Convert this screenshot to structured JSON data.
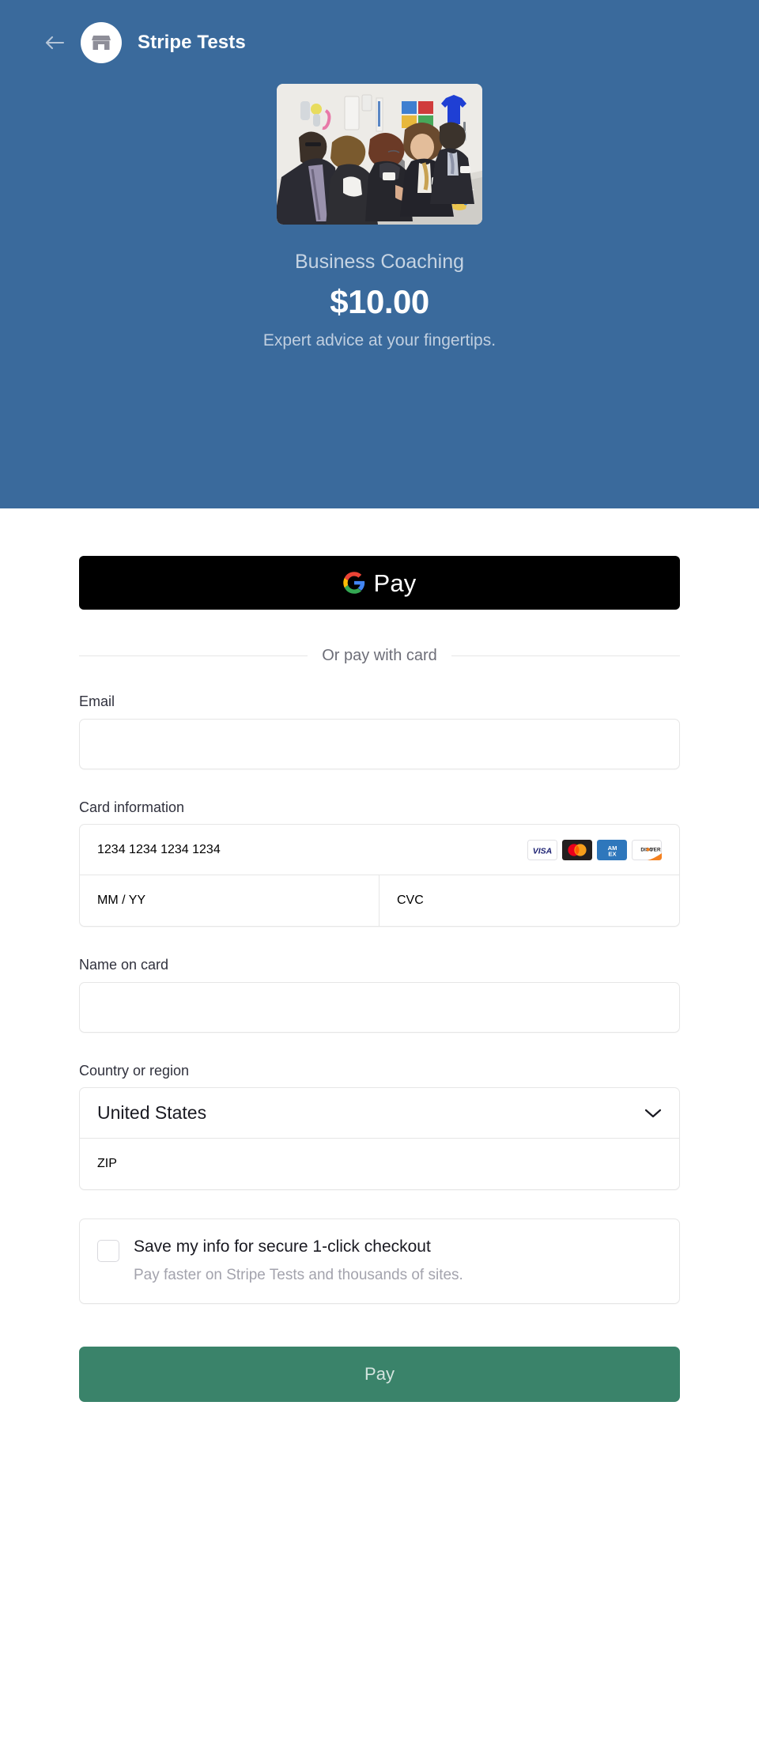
{
  "header": {
    "back_label": "Back",
    "back_icon": "arrow-left-icon",
    "logo_icon": "storefront-icon",
    "merchant_name": "Stripe Tests"
  },
  "product": {
    "image_alt": "Business meeting around a conference table",
    "name": "Business Coaching",
    "price": "$10.00",
    "description": "Expert advice at your fingertips."
  },
  "wallet": {
    "google_pay_label": "Pay",
    "google_pay_icon": "google-g-icon"
  },
  "divider": {
    "label": "Or pay with card"
  },
  "form": {
    "email": {
      "label": "Email",
      "value": "",
      "placeholder": ""
    },
    "card": {
      "label": "Card information",
      "number_placeholder": "1234 1234 1234 1234",
      "number_value": "",
      "expiry_placeholder": "MM / YY",
      "expiry_value": "",
      "cvc_placeholder": "CVC",
      "cvc_value": "",
      "brands": [
        "visa",
        "mastercard",
        "amex",
        "discover"
      ]
    },
    "name_on_card": {
      "label": "Name on card",
      "value": "",
      "placeholder": ""
    },
    "country": {
      "label": "Country or region",
      "selected": "United States",
      "chevron_icon": "chevron-down-icon",
      "zip_placeholder": "ZIP",
      "zip_value": ""
    },
    "save_info": {
      "checked": false,
      "title": "Save my info for secure 1-click checkout",
      "subtitle": "Pay faster on Stripe Tests and thousands of sites."
    },
    "submit_label": "Pay"
  },
  "colors": {
    "summary_background": "#3a6a9c",
    "pay_button": "#3a836a",
    "wallet_button": "#000000",
    "border": "#e6e6e6",
    "placeholder_text": "#a3a3ad",
    "label_text": "#30313d"
  }
}
